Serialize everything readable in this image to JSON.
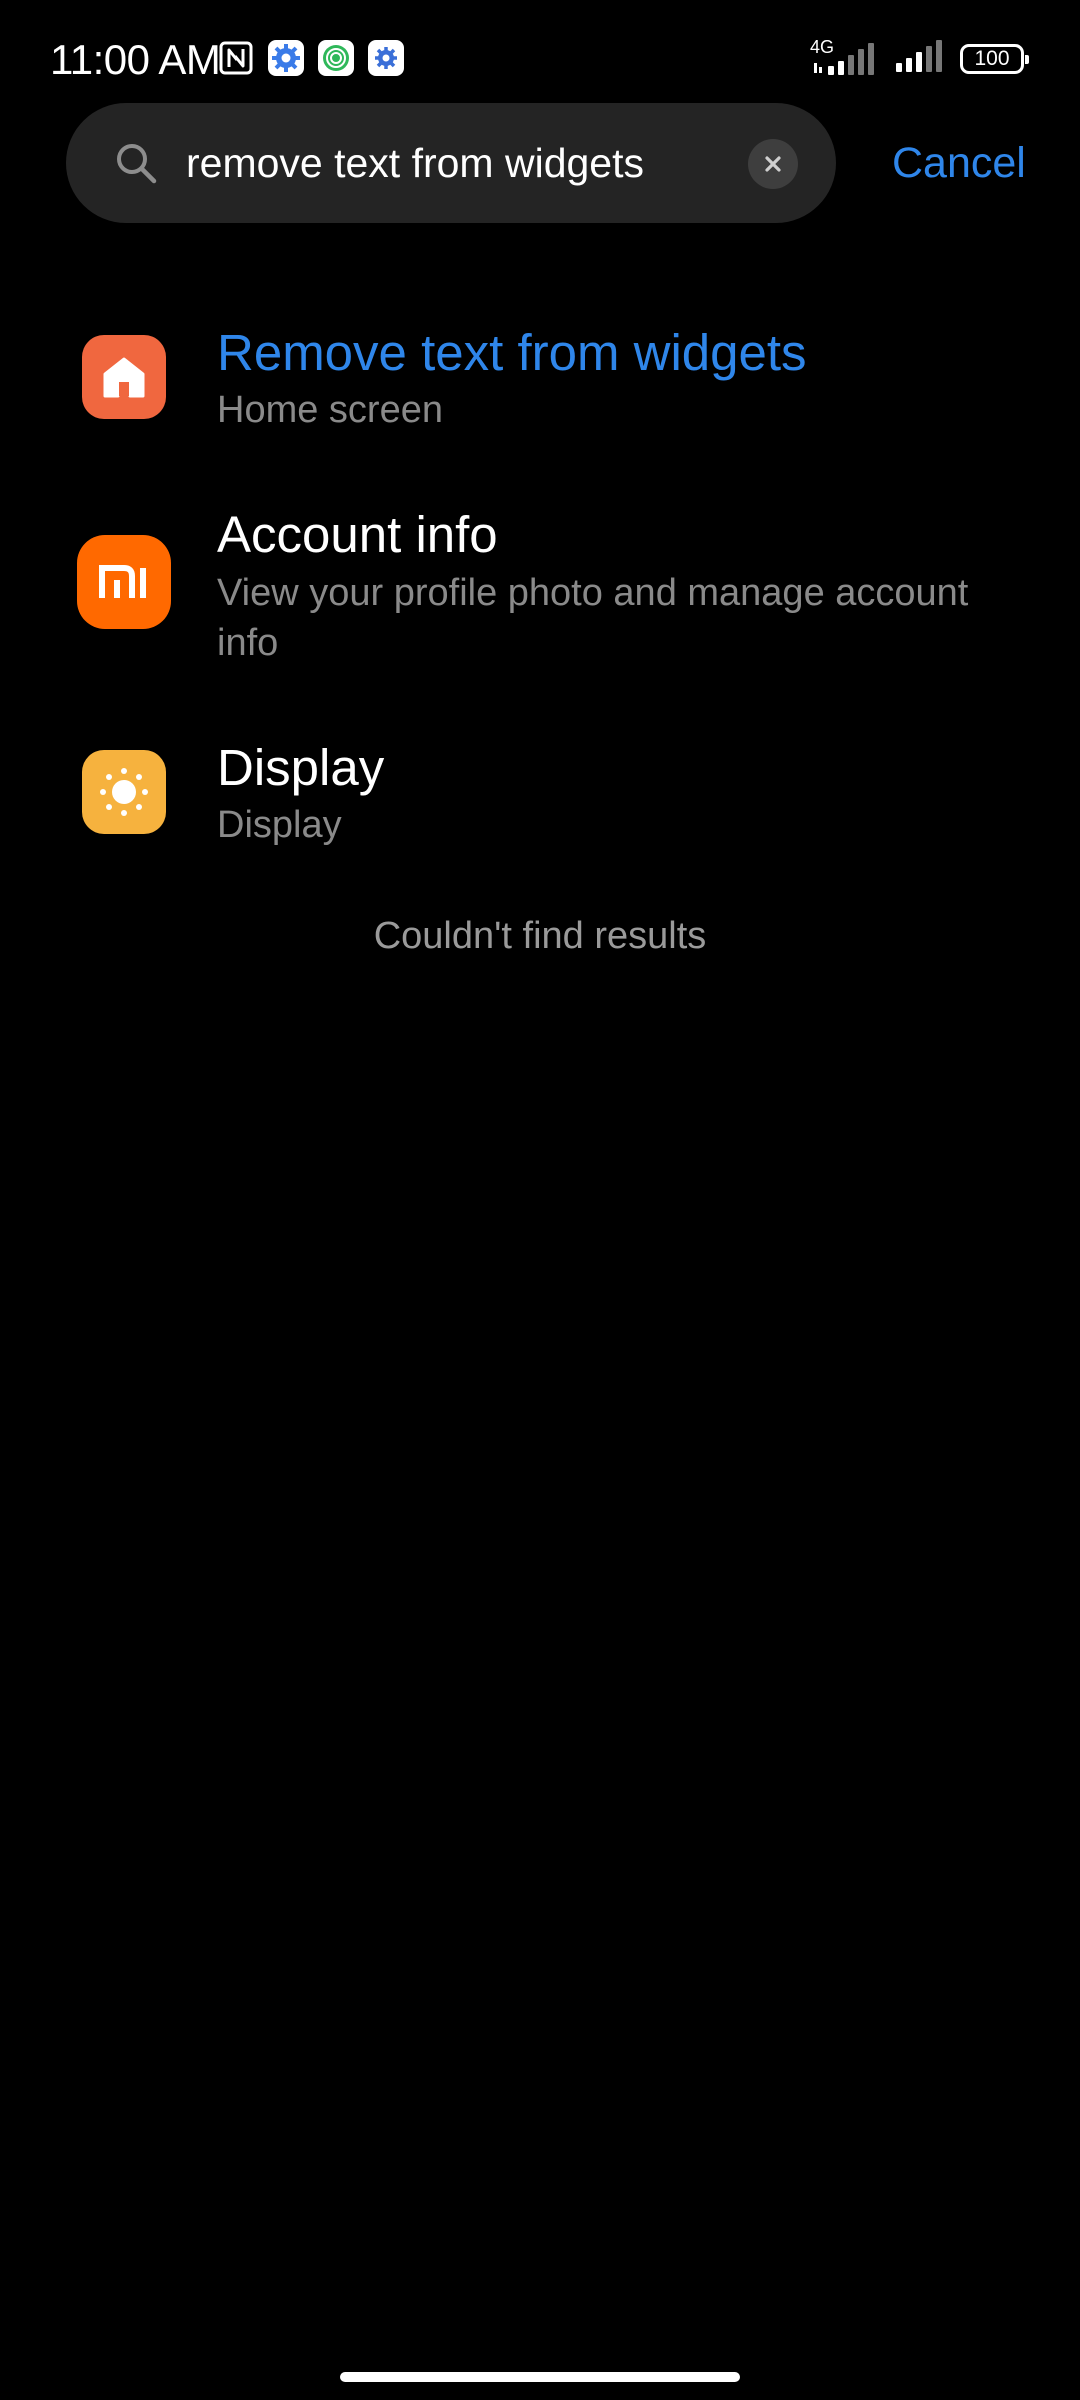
{
  "status_bar": {
    "time": "11:00 AM",
    "network_type": "4G",
    "battery_level": "100",
    "icons": [
      "nfc-icon",
      "settings-icon",
      "target-app-icon",
      "settings-icon",
      "signal-icon",
      "signal-icon",
      "battery-icon"
    ]
  },
  "search": {
    "query": "remove text from widgets",
    "cancel_label": "Cancel"
  },
  "results": [
    {
      "title": "Remove text from widgets",
      "subtitle": "Home screen",
      "icon": "home-icon",
      "icon_color": "#f0673f",
      "highlighted": true
    },
    {
      "title": "Account info",
      "subtitle": "View your profile photo and manage account info",
      "icon": "mi-logo-icon",
      "icon_color": "#ff6900",
      "highlighted": false
    },
    {
      "title": "Display",
      "subtitle": "Display",
      "icon": "sun-icon",
      "icon_color": "#f6b23e",
      "highlighted": false
    }
  ],
  "empty_message": "Couldn't find results",
  "colors": {
    "background": "#000000",
    "accent": "#2f86ea",
    "search_bg": "#242424",
    "secondary_text": "#8a8a8a"
  }
}
